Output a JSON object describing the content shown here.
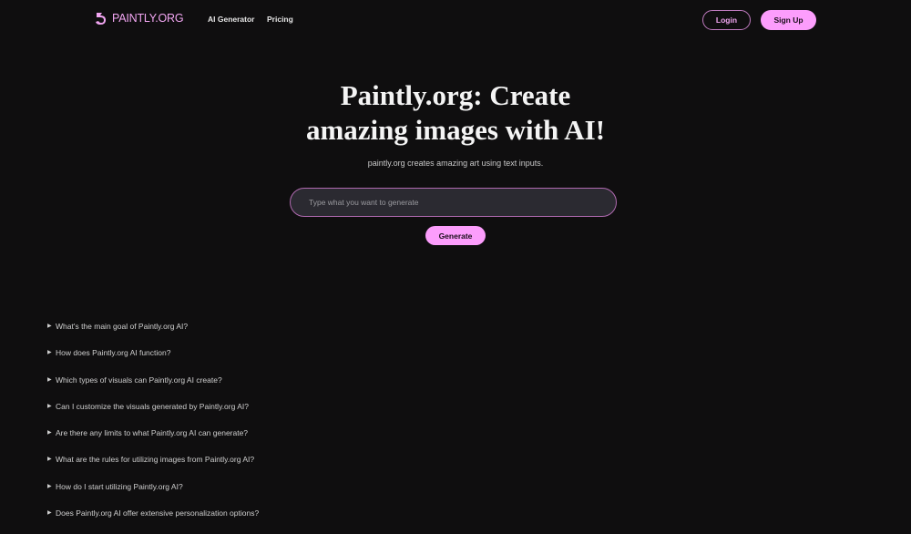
{
  "nav": {
    "logo_text": "PAINTLY.ORG",
    "links": [
      "AI Generator",
      "Pricing"
    ],
    "login_label": "Login",
    "signup_label": "Sign Up"
  },
  "hero": {
    "title_line1": "Paintly.org: Create",
    "title_line2": "amazing images with AI!",
    "subtitle": "paintly.org creates amazing art using text inputs.",
    "input_placeholder": "Type what you want to generate",
    "input_value": "",
    "generate_label": "Generate"
  },
  "faq": {
    "items": [
      "What's the main goal of Paintly.org AI?",
      "How does Paintly.org AI function?",
      "Which types of visuals can Paintly.org AI create?",
      "Can I customize the visuals generated by Paintly.org AI?",
      "Are there any limits to what Paintly.org AI can generate?",
      "What are the rules for utilizing images from Paintly.org AI?",
      "How do I start utilizing Paintly.org AI?",
      "Does Paintly.org AI offer extensive personalization options?"
    ]
  },
  "colors": {
    "background": "#0f0e0f",
    "accent": "#fc9dfc",
    "accent_border": "#b06ab0",
    "input_bg": "#2b2a31"
  }
}
